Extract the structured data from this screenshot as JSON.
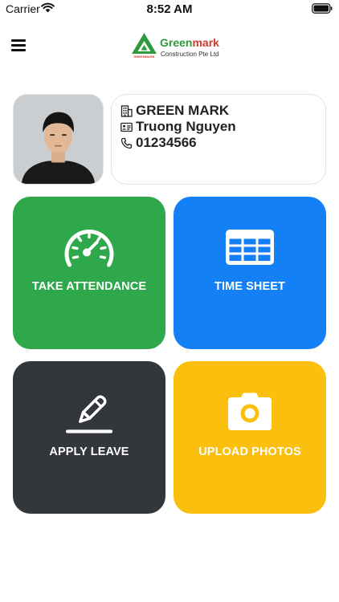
{
  "status_bar": {
    "carrier": "Carrier",
    "time": "8:52 AM"
  },
  "header": {
    "logo_title_green": "Green",
    "logo_title_red": "mark",
    "logo_subtitle": "Construction Pte Ltd",
    "logo_mark_text": "GREENMARK"
  },
  "profile": {
    "company": "GREEN MARK",
    "name": "Truong Nguyen",
    "phone": "01234566"
  },
  "tiles": [
    {
      "label": "TAKE ATTENDANCE",
      "color": "#2ea84a",
      "icon": "speedometer-icon"
    },
    {
      "label": "TIME SHEET",
      "color": "#1380f5",
      "icon": "table-icon"
    },
    {
      "label": "APPLY LEAVE",
      "color": "#33363b",
      "icon": "pencil-icon"
    },
    {
      "label": "UPLOAD PHOTOS",
      "color": "#fbbf0d",
      "icon": "camera-icon"
    }
  ]
}
